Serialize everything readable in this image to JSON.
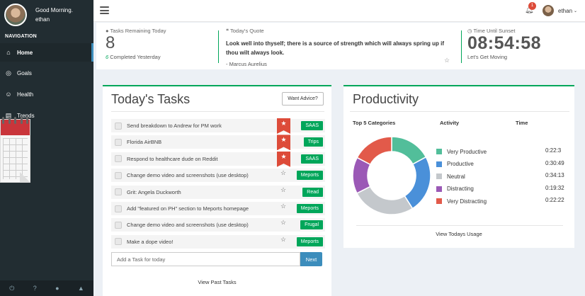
{
  "profile": {
    "greeting": "Good Morning.",
    "name": "ethan"
  },
  "nav": {
    "heading": "NAVIGATION",
    "items": [
      {
        "label": "Home",
        "icon": "home-icon"
      },
      {
        "label": "Goals",
        "icon": "target-icon"
      },
      {
        "label": "Health",
        "icon": "smile-icon"
      },
      {
        "label": "Trends",
        "icon": "chart-icon"
      }
    ]
  },
  "header": {
    "notification_count": "1",
    "username": "ethan"
  },
  "stats": {
    "tasks_label": "Tasks Remaining Today",
    "tasks_remaining": "8",
    "completed_count": "6",
    "completed_label": "Completed Yesterday",
    "quote_label": "Today's Quote",
    "quote_text": "Look well into thyself; there is a source of strength which will always spring up if thou wilt always look.",
    "quote_author": "- Marcus Aurelius",
    "sunset_label": "Time Until Sunset",
    "sunset_time": "08:54:58",
    "sunset_sub": "Let's Get Moving"
  },
  "tasks": {
    "title": "Today's Tasks",
    "advice_button": "Want Advice?",
    "items": [
      {
        "text": "Send breakdown to Andrew for PM work",
        "tag": "SAAS",
        "starred": true
      },
      {
        "text": "Florida AirBNB",
        "tag": "Trips",
        "starred": true
      },
      {
        "text": "Respond to healthcare dude on Reddit",
        "tag": "SAAS",
        "starred": true
      },
      {
        "text": "Change demo video and screenshots (use desktop)",
        "tag": "Meports",
        "starred": false
      },
      {
        "text": "Grit: Angela Duckworth",
        "tag": "Read",
        "starred": false
      },
      {
        "text": "Add \"featured on PH\" section to Meports homepage",
        "tag": "Meports",
        "starred": false
      },
      {
        "text": "Change demo video and screenshots (use desktop)",
        "tag": "Frugal",
        "starred": false
      },
      {
        "text": "Make a dope video!",
        "tag": "Meports",
        "starred": false
      }
    ],
    "add_placeholder": "Add a Task for today",
    "next_button": "Next",
    "past_link": "View Past Tasks"
  },
  "productivity": {
    "title": "Productivity",
    "col_categories": "Top 5 Categories",
    "col_activity": "Activity",
    "col_time": "Time",
    "usage_link": "View Todays Usage"
  },
  "chart_data": {
    "type": "pie",
    "categories": [
      "Very Productive",
      "Productive",
      "Neutral",
      "Distracting",
      "Very Distracting"
    ],
    "times": [
      "0:22:3",
      "0:30:49",
      "0:34:13",
      "0:19:32",
      "0:22:22"
    ],
    "values": [
      22.05,
      30.82,
      34.22,
      19.53,
      22.37
    ],
    "colors": [
      "#52be9a",
      "#4a90d9",
      "#c4c8cc",
      "#9b59b6",
      "#e25a4a"
    ]
  }
}
